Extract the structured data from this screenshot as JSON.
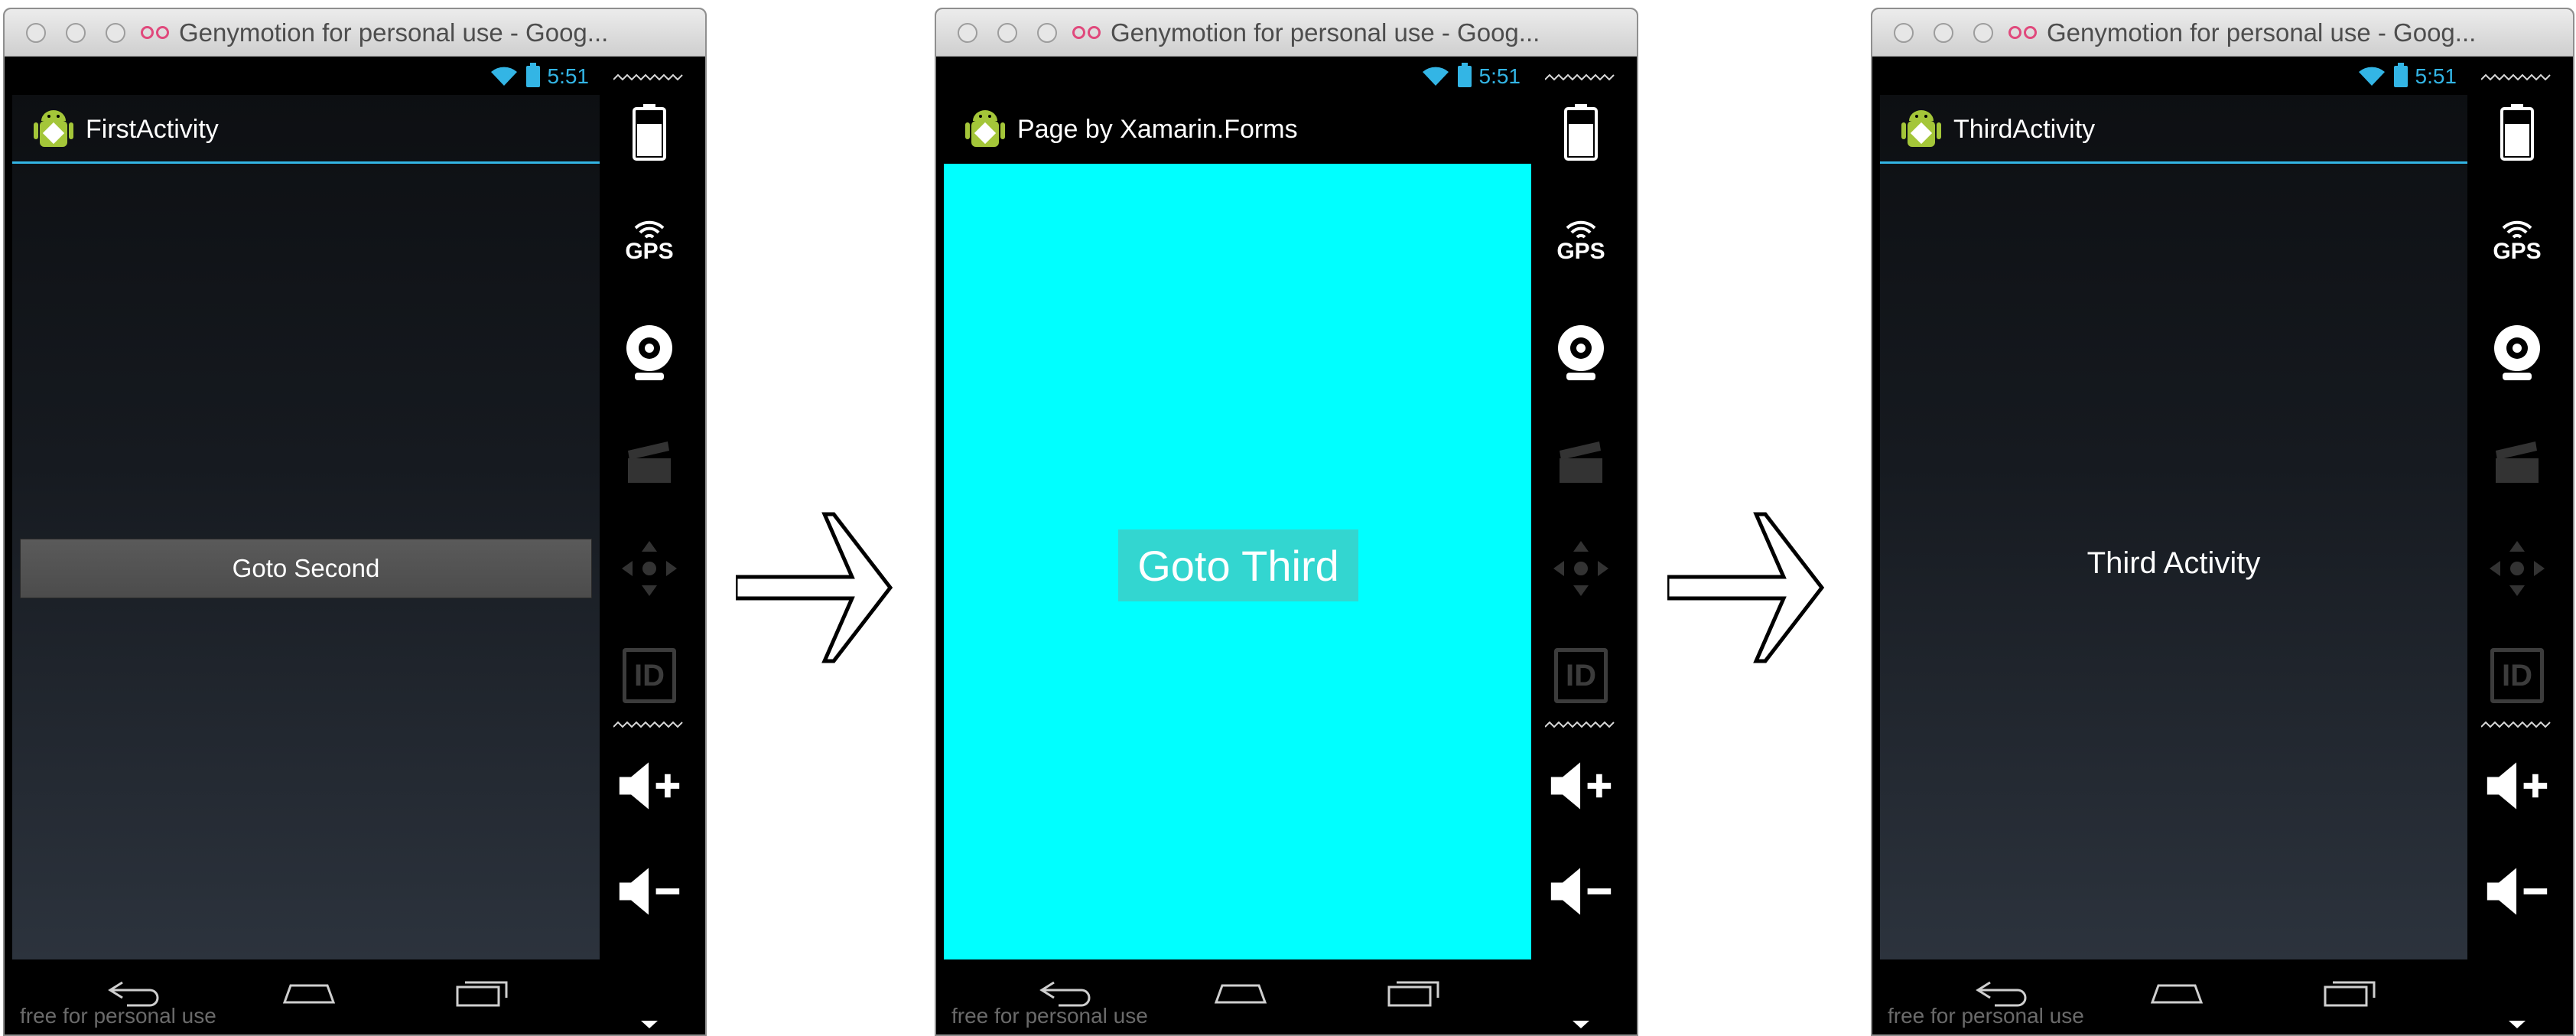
{
  "window_title": "Genymotion for personal use - Goog...",
  "status_time": "5:51",
  "watermark": "free for personal use",
  "screens": [
    {
      "app_title": "FirstActivity",
      "button_label": "Goto Second"
    },
    {
      "app_title": "Page by Xamarin.Forms",
      "button_label": "Goto Third",
      "background_color": "#00ffff"
    },
    {
      "app_title": "ThirdActivity",
      "center_label": "Third Activity"
    }
  ],
  "sidebar": {
    "items": [
      "battery-icon",
      "gps-icon",
      "webcam-icon",
      "video-capture-icon",
      "dpad-icon",
      "id-icon",
      "volume-up-icon",
      "volume-down-icon"
    ],
    "gps_label": "GPS",
    "id_label": "ID"
  },
  "accent_color": "#33b5e5"
}
